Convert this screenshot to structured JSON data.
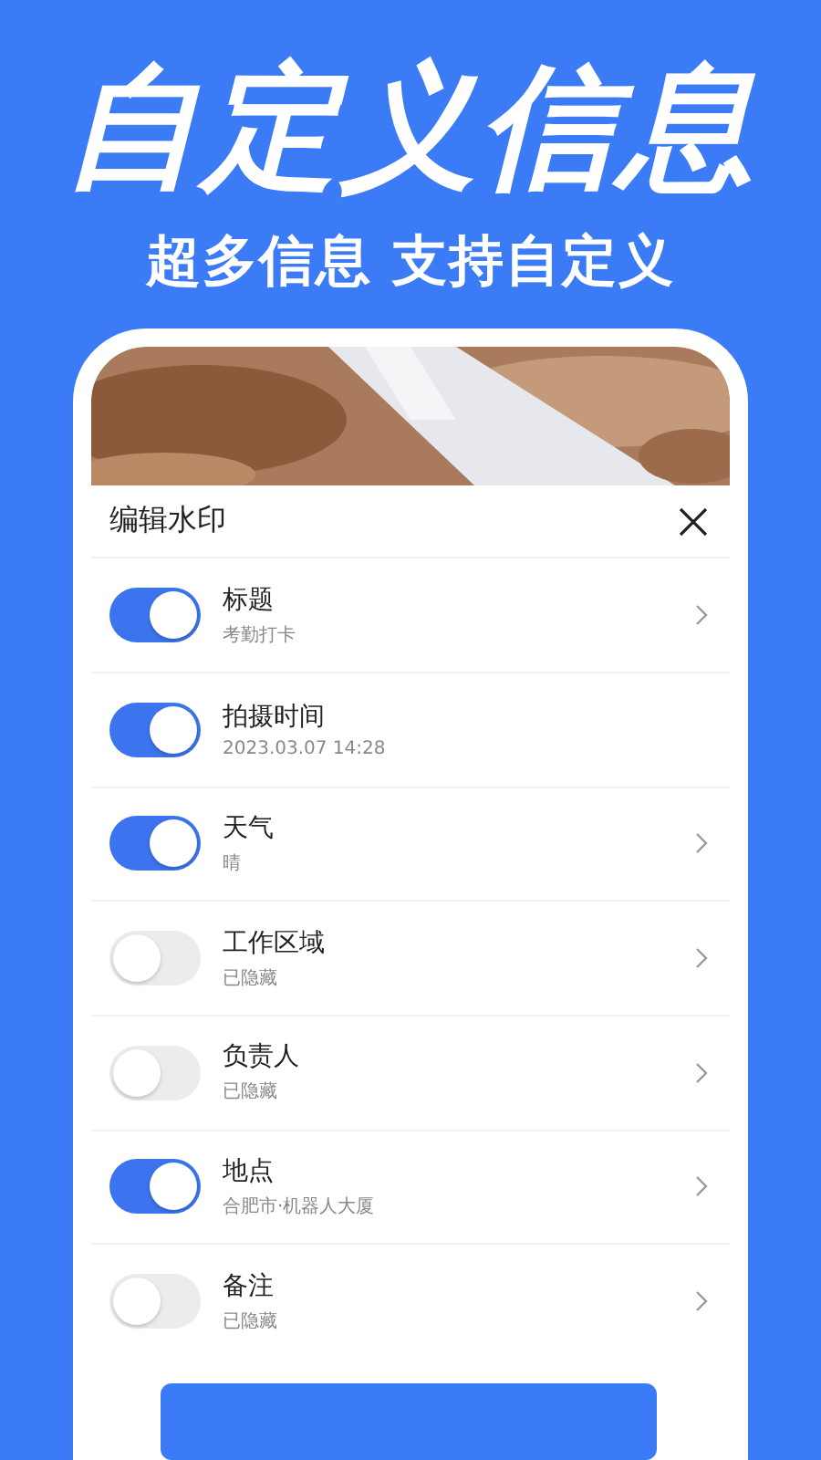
{
  "headline": "自定义信息",
  "subtitle": "超多信息 支持自定义",
  "sheet": {
    "title": "编辑水印",
    "rows": [
      {
        "title": "标题",
        "detail": "考勤打卡",
        "on": true,
        "chevron": true
      },
      {
        "title": "拍摄时间",
        "detail": "2023.03.07 14:28",
        "on": true,
        "chevron": false
      },
      {
        "title": "天气",
        "detail": "晴",
        "on": true,
        "chevron": true
      },
      {
        "title": "工作区域",
        "detail": "已隐藏",
        "on": false,
        "chevron": true
      },
      {
        "title": "负责人",
        "detail": "已隐藏",
        "on": false,
        "chevron": true
      },
      {
        "title": "地点",
        "detail": "合肥市·机器人大厦",
        "on": true,
        "chevron": true
      },
      {
        "title": "备注",
        "detail": "已隐藏",
        "on": false,
        "chevron": true
      }
    ]
  }
}
